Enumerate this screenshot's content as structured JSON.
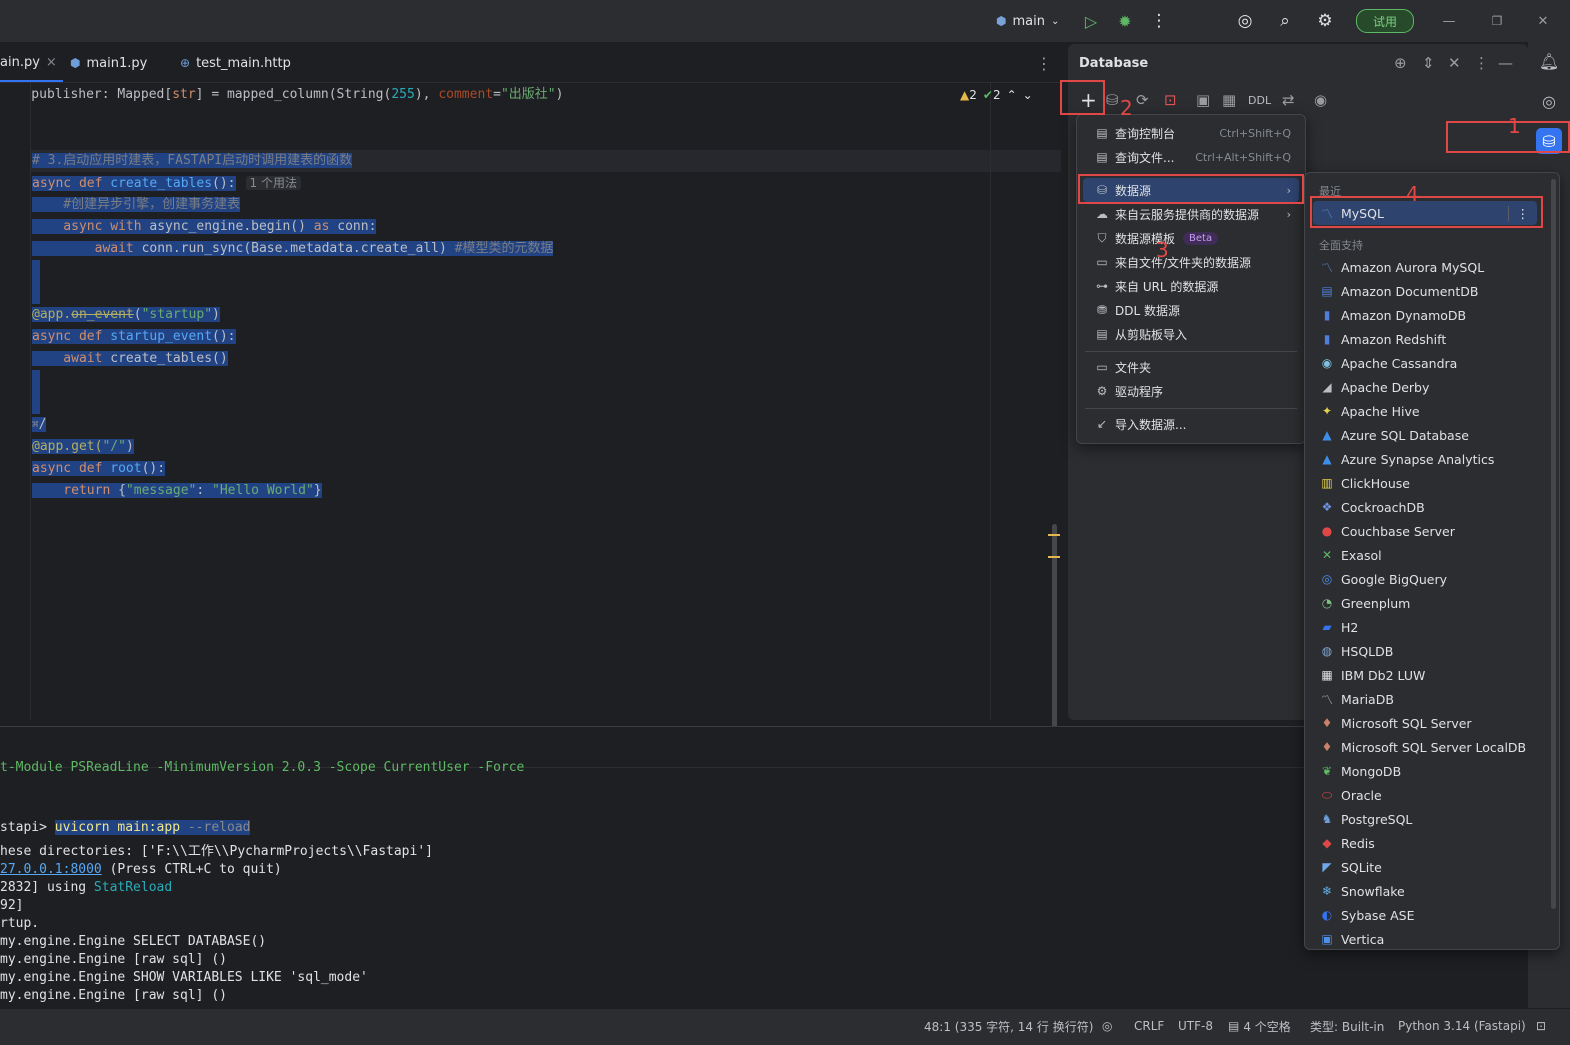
{
  "titlebar": {
    "branch": "main",
    "trial_label": "试用"
  },
  "editor": {
    "tabs": [
      {
        "label": "ain.py",
        "close": "×"
      },
      {
        "label": "main1.py"
      },
      {
        "label": "test_main.http"
      }
    ],
    "inspections": {
      "warnings": "2",
      "ok": "2"
    },
    "code": {
      "l1_a": "    publisher: Mapped[",
      "l1_b": "str",
      "l1_c": "] = mapped_column(String(",
      "l1_d": "255",
      "l1_e": "), ",
      "l1_f": "comment",
      "l1_g": "=",
      "l1_h": "\"出版社\"",
      "l1_i": ")",
      "l2": "# 3.启动应用时建表，FASTAPI启动时调用建表的函数",
      "l3_kw": "async def ",
      "l3_fn": "create_tables",
      "l3_rest": "():",
      "l3_hint": "1 个用法",
      "l4": "    #创建异步引擎，创建事务建表",
      "l5_kw1": "    async with ",
      "l5_mid": "async_engine.begin() ",
      "l5_kw2": "as",
      "l5_rest": " conn:",
      "l6_kw": "        await ",
      "l6_rest": "conn.run_sync(Base.metadata.create_all) ",
      "l6_cm": "#模型类的元数据",
      "l7_dec": "@app.",
      "l7_strike": "on_event",
      "l7_a": "(",
      "l7_str": "\"startup\"",
      "l7_b": ")",
      "l8_kw": "async def ",
      "l8_fn": "startup_event",
      "l8_rest": "():",
      "l9_kw": "    await ",
      "l9_rest": "create_tables()",
      "l10": "/",
      "l11_dec": "@app.get(",
      "l11_str": "\"/\"",
      "l11_b": ")",
      "l12_kw": "async def ",
      "l12_fn": "root",
      "l12_rest": "():",
      "l13_kw": "    return ",
      "l13_a": "{",
      "l13_s1": "\"message\"",
      "l13_b": ": ",
      "l13_s2": "\"Hello World\"",
      "l13_c": "}"
    }
  },
  "terminal": {
    "lines": {
      "partial": "t-Module PSReadLine -MinimumVersion 2.0.3 -Scope CurrentUser -Force",
      "prompt": "stapi> ",
      "cmd": "uvicorn main:app",
      "cmd_flag": " --reload",
      "dirs": "hese directories: ['F:\\\\工作\\\\PycharmProjects\\\\Fastapi']",
      "url": "27.0.0.1:8000",
      "url_rest": " (Press CTRL+C to quit)",
      "reload_a": "2832] using ",
      "reload_b": "StatReload",
      "pid": "92]",
      "startup": "rtup.",
      "e1": "my.engine.Engine SELECT DATABASE()",
      "e2": "my.engine.Engine [raw sql] ()",
      "e3": "my.engine.Engine SHOW VARIABLES LIKE 'sql_mode'",
      "e4": "my.engine.Engine [raw sql] ()"
    }
  },
  "database": {
    "title": "Database",
    "ddl_label": "DDL",
    "menu": [
      {
        "label": "查询控制台",
        "shortcut": "Ctrl+Shift+Q"
      },
      {
        "label": "查询文件...",
        "shortcut": "Ctrl+Alt+Shift+Q"
      },
      {
        "label": "数据源"
      },
      {
        "label": "来自云服务提供商的数据源"
      },
      {
        "label": "数据源模板",
        "badge": "Beta"
      },
      {
        "label": "来自文件/文件夹的数据源"
      },
      {
        "label": "来自 URL 的数据源"
      },
      {
        "label": "DDL 数据源"
      },
      {
        "label": "从剪贴板导入"
      },
      {
        "label": "文件夹"
      },
      {
        "label": "驱动程序"
      },
      {
        "label": "导入数据源..."
      }
    ],
    "submenu": {
      "recent_header": "最近",
      "recent": [
        "MySQL"
      ],
      "full_header": "全面支持",
      "items": [
        "Amazon Aurora MySQL",
        "Amazon DocumentDB",
        "Amazon DynamoDB",
        "Amazon Redshift",
        "Apache Cassandra",
        "Apache Derby",
        "Apache Hive",
        "Azure SQL Database",
        "Azure Synapse Analytics",
        "ClickHouse",
        "CockroachDB",
        "Couchbase Server",
        "Exasol",
        "Google BigQuery",
        "Greenplum",
        "H2",
        "HSQLDB",
        "IBM Db2 LUW",
        "MariaDB",
        "Microsoft SQL Server",
        "Microsoft SQL Server LocalDB",
        "MongoDB",
        "Oracle",
        "PostgreSQL",
        "Redis",
        "SQLite",
        "Snowflake",
        "Sybase ASE",
        "Vertica"
      ]
    }
  },
  "annotations": [
    "1",
    "2",
    "3",
    "4"
  ],
  "statusbar": {
    "position": "48:1 (335 字符, 14 行 换行符)",
    "line_sep": "CRLF",
    "encoding": "UTF-8",
    "indent": "4 个空格",
    "type": "类型: Built-in",
    "interpreter": "Python 3.14 (Fastapi)"
  }
}
